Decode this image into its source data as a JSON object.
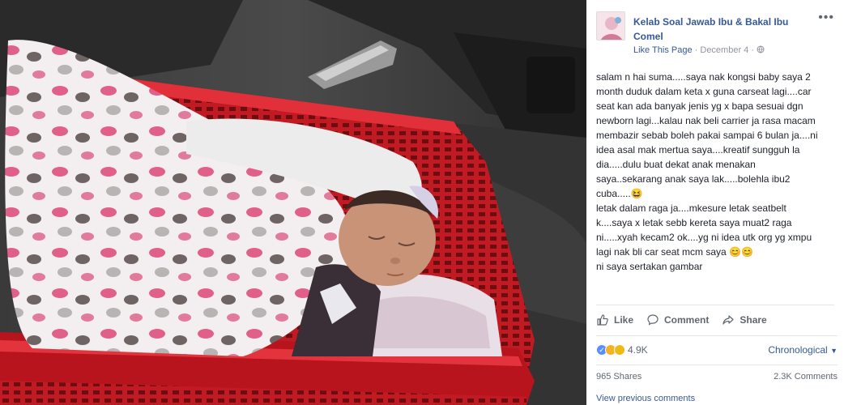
{
  "post": {
    "page_name": "Kelab Soal Jawab Ibu & Bakal Ibu Comel",
    "like_link": "Like This Page",
    "date": "December 4",
    "separator": "·",
    "text_lines": [
      "salam n hai suma.....saya nak kongsi baby saya 2",
      "month duduk dalam keta x guna carseat lagi....car",
      "seat kan ada banyak jenis yg x bapa sesuai dgn",
      "newborn lagi...kalau nak beli carrier ja rasa macam",
      "membazir sebab boleh pakai sampai 6 bulan ja....ni",
      "idea asal mak mertua saya....kreatif sungguh la",
      "dia.....dulu buat dekat anak menakan",
      "saya..sekarang anak saya lak.....bolehla ibu2",
      "cuba.....😆",
      "letak dalam raga ja....mkesure letak seatbelt",
      "k....saya x letak sebb kereta saya muat2 raga",
      "ni.....xyah kecam2 ok....yg ni idea utk org yg xmpu",
      "lagi nak bli car seat mcm saya 😊😊",
      "ni saya sertakan gambar"
    ]
  },
  "actions": {
    "like": "Like",
    "comment": "Comment",
    "share": "Share"
  },
  "stats": {
    "reaction_count": "4.9K",
    "sort_label": "Chronological",
    "shares": "965 Shares",
    "comments": "2.3K Comments",
    "view_previous": "View previous comments"
  },
  "colors": {
    "link": "#365899",
    "muted": "#90949c",
    "basket": "#d0202a"
  }
}
